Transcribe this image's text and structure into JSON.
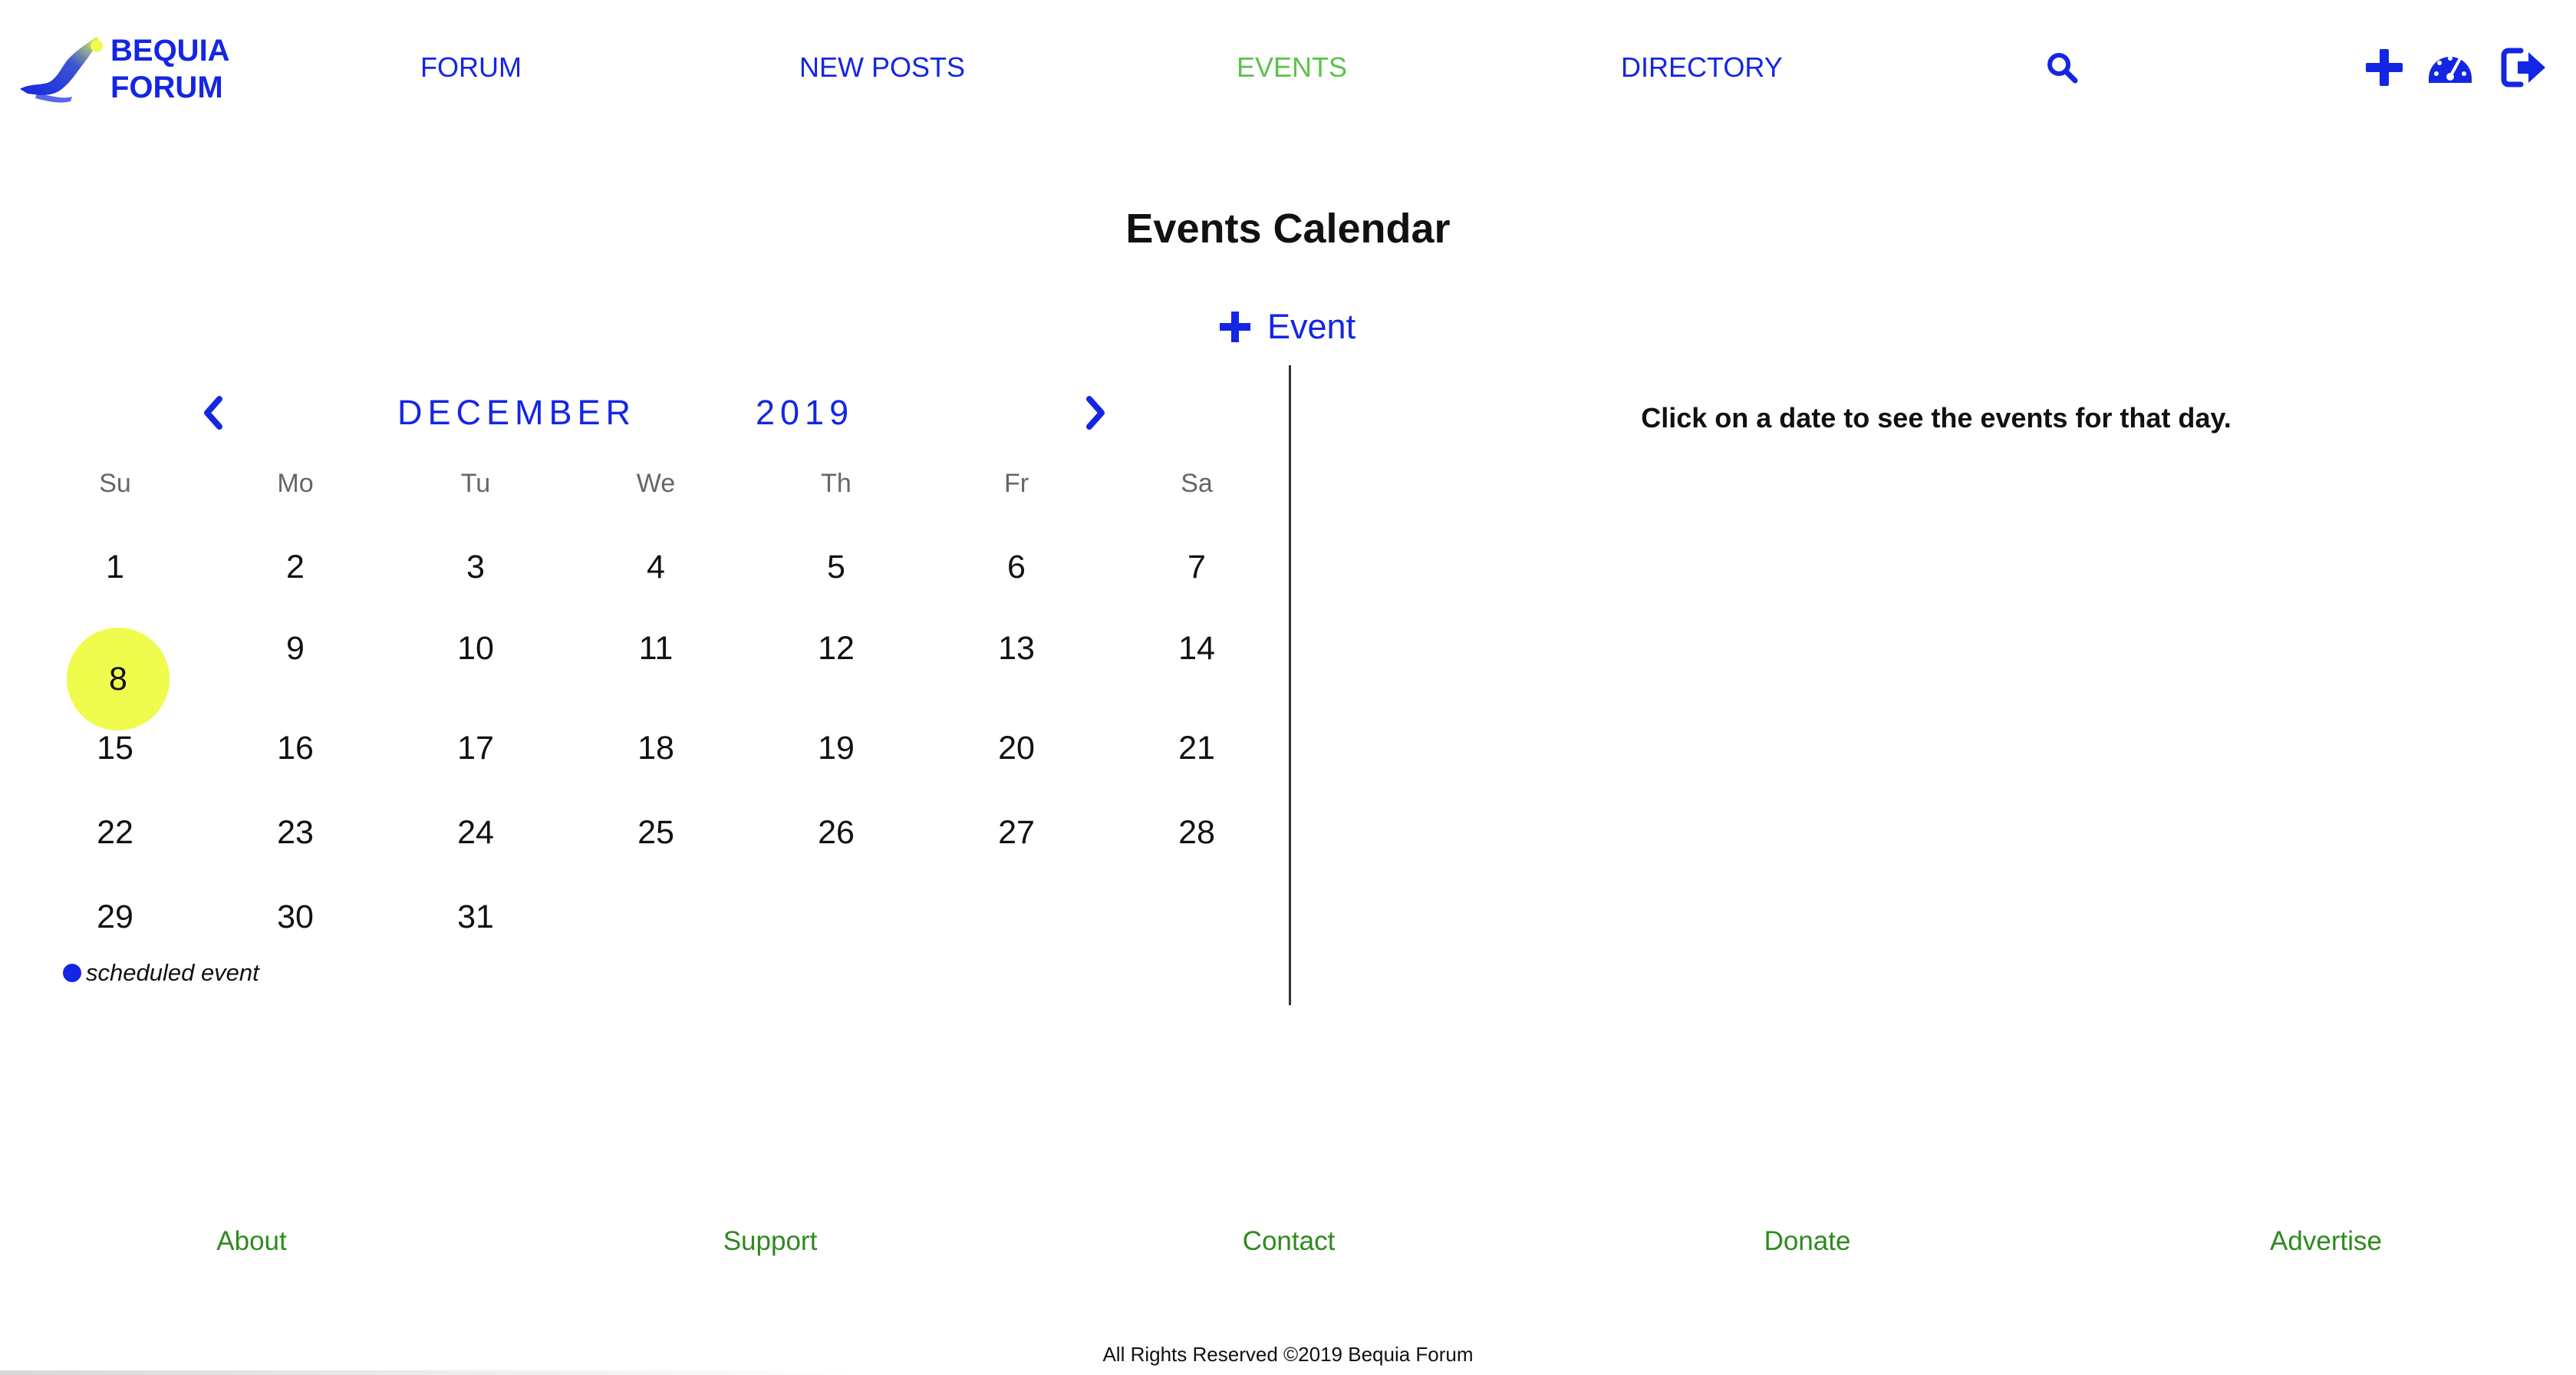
{
  "brand": {
    "line1": "BEQUIA",
    "line2": "FORUM"
  },
  "nav": {
    "forum": "FORUM",
    "new_posts": "NEW POSTS",
    "events": "EVENTS",
    "directory": "DIRECTORY",
    "active": "EVENTS"
  },
  "header_icons": [
    "search-icon",
    "add-icon",
    "dashboard-icon",
    "logout-icon"
  ],
  "page": {
    "title": "Events Calendar",
    "add_event_label": "Event"
  },
  "calendar": {
    "month": "DECEMBER",
    "year": "2019",
    "weekdays": [
      "Su",
      "Mo",
      "Tu",
      "We",
      "Th",
      "Fr",
      "Sa"
    ],
    "weeks": [
      [
        "1",
        "2",
        "3",
        "4",
        "5",
        "6",
        "7"
      ],
      [
        "8",
        "9",
        "10",
        "11",
        "12",
        "13",
        "14"
      ],
      [
        "15",
        "16",
        "17",
        "18",
        "19",
        "20",
        "21"
      ],
      [
        "22",
        "23",
        "24",
        "25",
        "26",
        "27",
        "28"
      ],
      [
        "29",
        "30",
        "31"
      ]
    ],
    "highlighted_day": "8",
    "legend": "scheduled event"
  },
  "events_panel": {
    "hint": "Click on a date to see the events for that day."
  },
  "footer": {
    "about": "About",
    "support": "Support",
    "contact": "Contact",
    "donate": "Donate",
    "advertise": "Advertise",
    "copyright": "All Rights Reserved ©2019 Bequia Forum"
  },
  "colors": {
    "brand_blue": "#1426e3",
    "active_green": "#5cc24a",
    "footer_green": "#2e8a1e",
    "highlight_yellow": "#effb4d"
  }
}
